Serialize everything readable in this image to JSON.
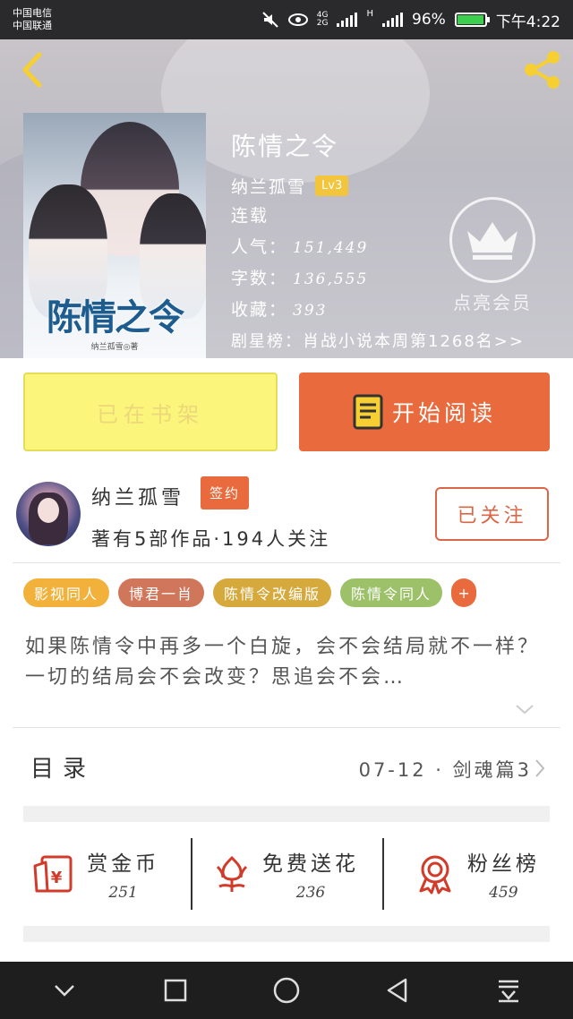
{
  "status_bar": {
    "carrier_1": "中国电信",
    "carrier_2": "中国联通",
    "network_1": "4G",
    "network_2": "2G",
    "network_3": "H",
    "battery": "96%",
    "time": "下午4:22"
  },
  "header": {
    "cover_title": "陈情之令",
    "cover_author": "纳兰孤雪◎著",
    "title": "陈情之令",
    "author": "纳兰孤雪",
    "level": "Lv3",
    "status": "连载",
    "popularity_label": "人气：",
    "popularity": "151,449",
    "words_label": "字数：",
    "words": "136,555",
    "favorites_label": "收藏：",
    "favorites": "393",
    "rank_label": "剧星榜：",
    "rank": "肖战小说本周第1268名>>",
    "vip_label": "点亮会员"
  },
  "actions": {
    "shelf": "已在书架",
    "read": "开始阅读"
  },
  "author": {
    "name": "纳兰孤雪",
    "badge": "签约",
    "stats": "著有5部作品·194人关注",
    "follow": "已关注"
  },
  "tags": [
    {
      "label": "影视同人",
      "color": "#f2b13a"
    },
    {
      "label": "博君一肖",
      "color": "#d0765a"
    },
    {
      "label": "陈情令改编版",
      "color": "#d6a93d"
    },
    {
      "label": "陈情令同人",
      "color": "#9cc168"
    }
  ],
  "tag_more": "+",
  "description": "如果陈情令中再多一个白旋，会不会结局就不一样？一切的结局会不会改变？思追会不会…",
  "catalog": {
    "label": "目录",
    "latest": "07-12 · 剑魂篇3"
  },
  "rewards": [
    {
      "label": "赏金币",
      "count": "251",
      "icon": "red-envelope-icon"
    },
    {
      "label": "免费送花",
      "count": "236",
      "icon": "flower-icon"
    },
    {
      "label": "粉丝榜",
      "count": "459",
      "icon": "medal-icon"
    }
  ],
  "colors": {
    "accent": "#e96a3c",
    "shelf_button": "#fbf57c",
    "icon_yellow": "#f6cf33"
  }
}
